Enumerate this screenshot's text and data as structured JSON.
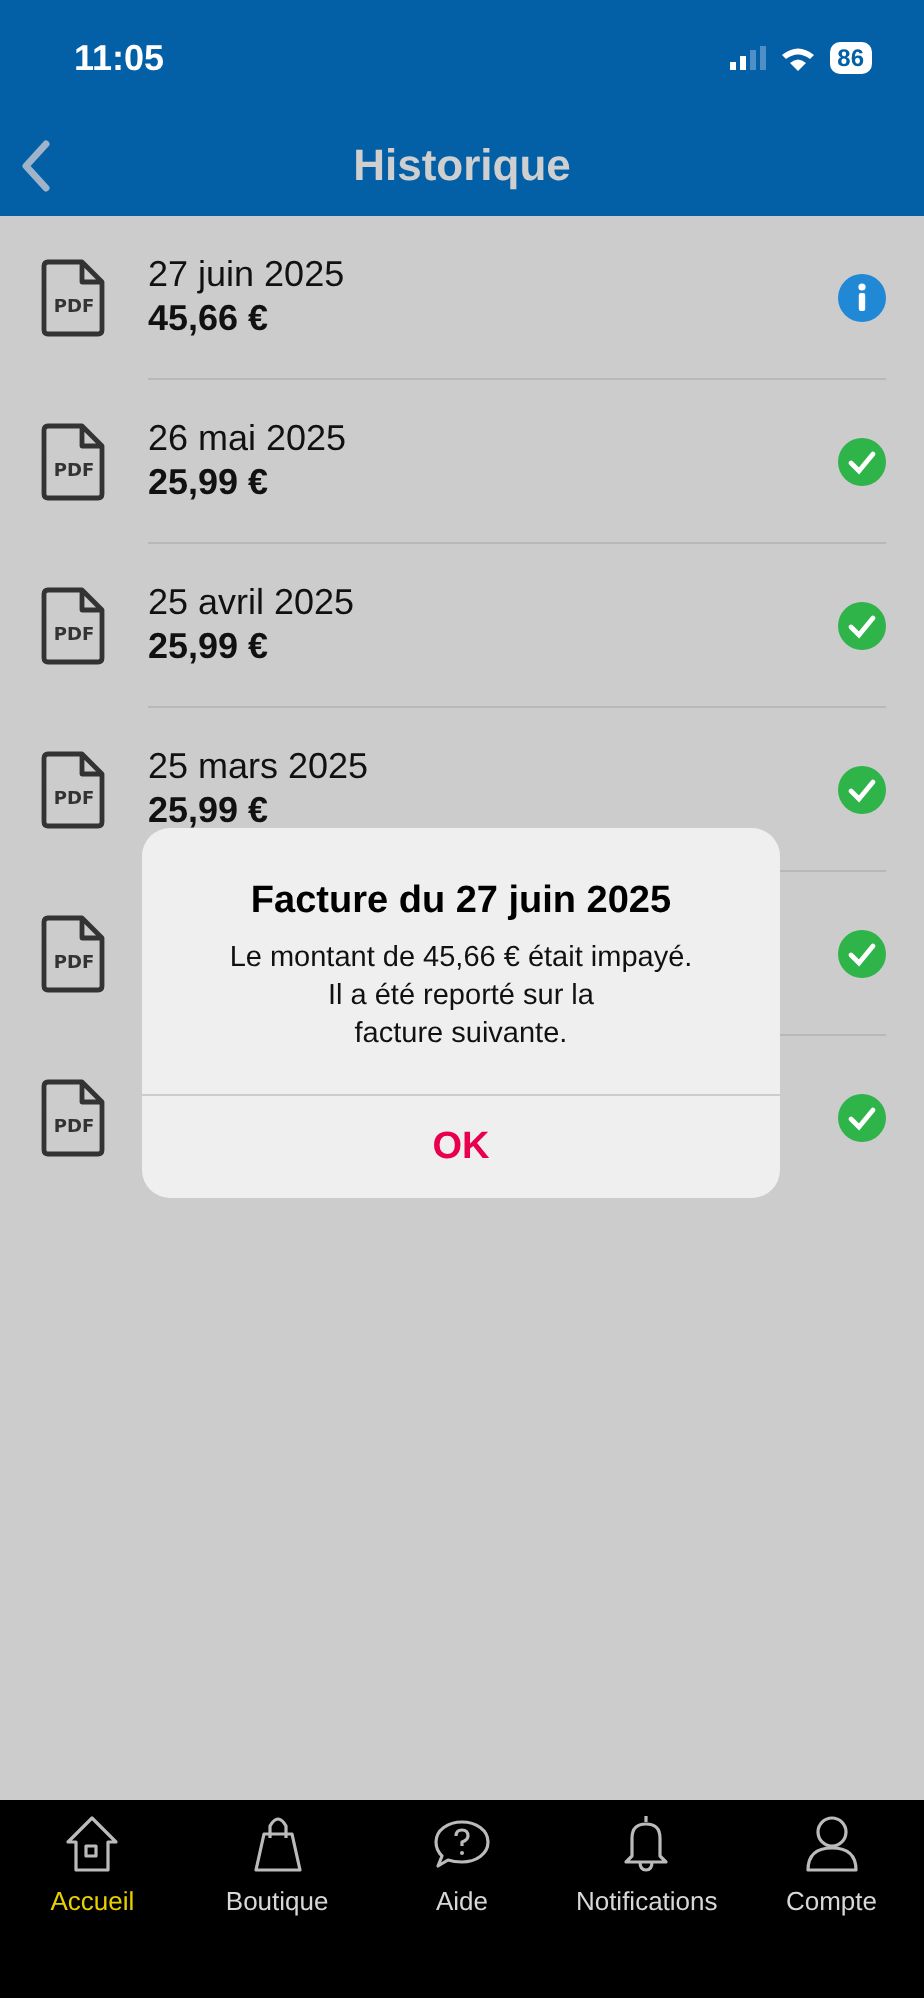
{
  "status_bar": {
    "time": "11:05",
    "battery": "86"
  },
  "nav": {
    "title": "Historique"
  },
  "invoices": [
    {
      "file_label": "PDF",
      "date": "27 juin 2025",
      "amount": "45,66 €",
      "kind": "info"
    },
    {
      "file_label": "PDF",
      "date": "26 mai 2025",
      "amount": "25,99 €",
      "kind": "paid"
    },
    {
      "file_label": "PDF",
      "date": "25 avril 2025",
      "amount": "25,99 €",
      "kind": "paid"
    },
    {
      "file_label": "PDF",
      "date": "25 mars 2025",
      "amount": "25,99 €",
      "kind": "paid"
    },
    {
      "file_label": "PDF",
      "kind": "paid"
    },
    {
      "file_label": "PDF",
      "kind": "paid"
    }
  ],
  "dialog": {
    "title": "Facture du 27 juin 2025",
    "message": "Le montant de 45,66 € était impayé.\nIl a été reporté sur la\nfacture suivante.",
    "button": "OK"
  },
  "tab_bar": [
    {
      "label": "Accueil",
      "selected": true
    },
    {
      "label": "Boutique",
      "selected": false
    },
    {
      "label": "Aide",
      "selected": false
    },
    {
      "label": "Notifications",
      "selected": false
    },
    {
      "label": "Compte",
      "selected": false
    }
  ]
}
